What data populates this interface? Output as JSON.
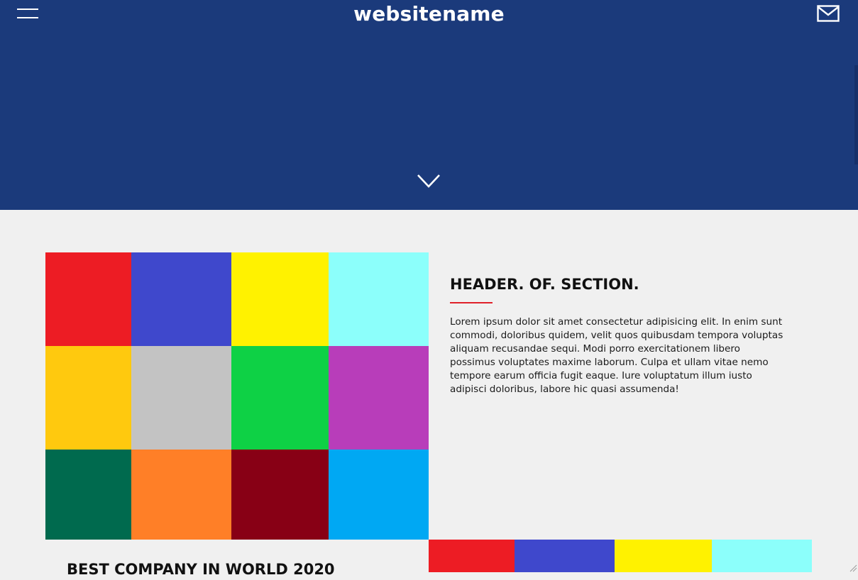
{
  "header": {
    "site_name": "websitename",
    "menu_icon": "hamburger-menu-icon",
    "mail_icon": "envelope-icon",
    "scroll_icon": "chevron-down-icon",
    "background": "#1b3a7b"
  },
  "section": {
    "title": "HEADER. OF. SECTION.",
    "accent": "#e0202a",
    "body": "Lorem ipsum dolor sit amet consectetur adipisicing elit. In enim sunt commodi, doloribus quidem, velit quos quibusdam tempora voluptas aliquam recusandae sequi. Modi porro exercitationem libero possimus voluptates maxime laborum. Culpa et ullam vitae nemo tempore earum officia fugit eaque. Iure voluptatum illum iusto adipisci doloribus, labore hic quasi assumenda!"
  },
  "color_grid": {
    "colors": [
      [
        "#ed1c24",
        "#3f48cc",
        "#fff200",
        "#8cfffb"
      ],
      [
        "#ffc90e",
        "#c3c3c3",
        "#0ed145",
        "#b83dba"
      ],
      [
        "#006a4e",
        "#ff7f27",
        "#880015",
        "#00a8f3"
      ]
    ]
  },
  "second_grid": {
    "colors": [
      "#ed1c24",
      "#3f48cc",
      "#fff200",
      "#8cfffb"
    ]
  },
  "next_section": {
    "title": "BEST COMPANY IN WORLD 2020"
  },
  "page_background": "#f0f0f0"
}
